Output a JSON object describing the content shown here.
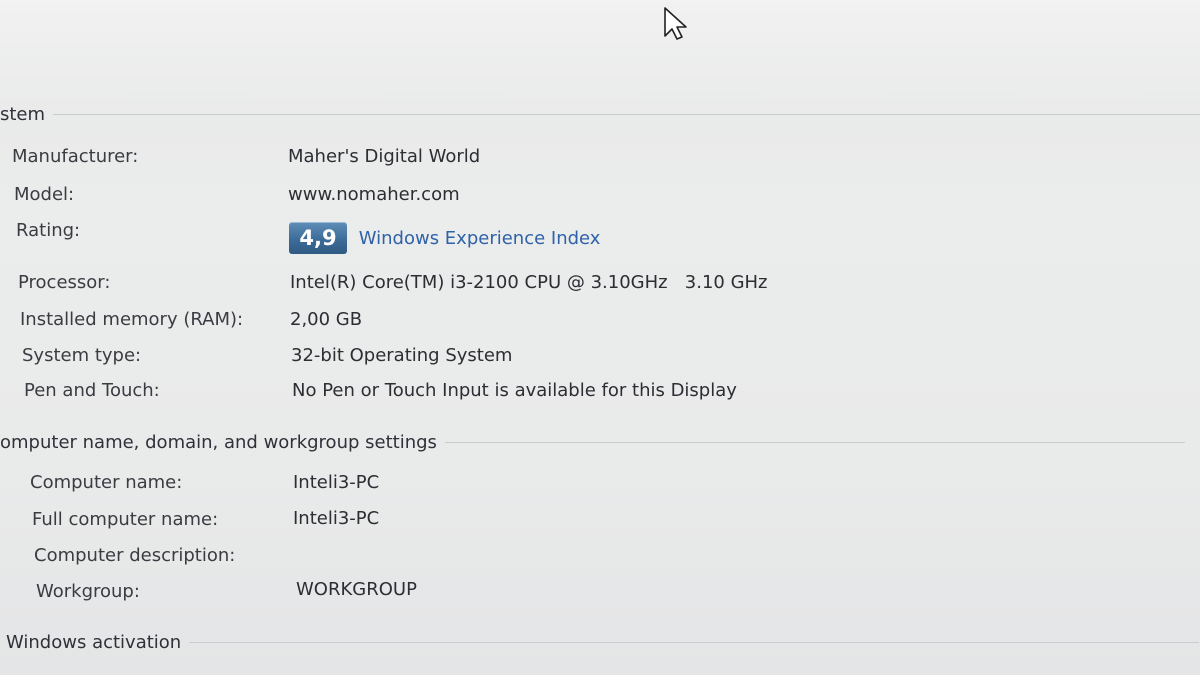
{
  "system_section": {
    "header": "stem",
    "rows": [
      {
        "label": "Manufacturer:",
        "value": "Maher's Digital World"
      },
      {
        "label": "Model:",
        "value": "www.nomaher.com"
      },
      {
        "label": "Rating:",
        "rating_score": "4,9",
        "rating_link": "Windows Experience Index"
      },
      {
        "label": "Processor:",
        "value": "Intel(R) Core(TM) i3-2100 CPU @ 3.10GHz   3.10 GHz"
      },
      {
        "label": "Installed memory (RAM):",
        "value": "2,00 GB"
      },
      {
        "label": "System type:",
        "value": "32-bit Operating System"
      },
      {
        "label": "Pen and Touch:",
        "value": "No Pen or Touch Input is available for this Display"
      }
    ]
  },
  "computer_section": {
    "header": "omputer name, domain, and workgroup settings",
    "rows": [
      {
        "label": "Computer name:",
        "value": "Inteli3-PC"
      },
      {
        "label": "Full computer name:",
        "value": "Inteli3-PC"
      },
      {
        "label": "Computer description:",
        "value": ""
      },
      {
        "label": "Workgroup:",
        "value": "WORKGROUP"
      }
    ]
  },
  "activation_section": {
    "header": "Windows activation"
  },
  "colors": {
    "link": "#2f62a8",
    "badge": "#3c6c98",
    "background": "#e9eaea"
  }
}
